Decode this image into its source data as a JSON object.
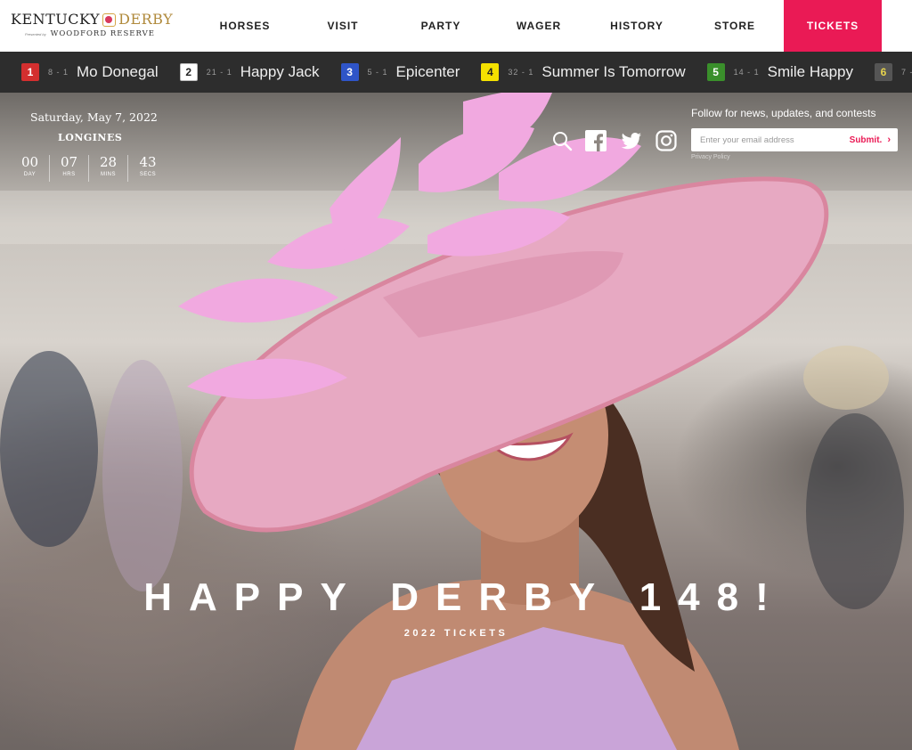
{
  "brand": {
    "name_part1": "KENTUCKY",
    "name_part2": "DERBY",
    "presented_by": "Presented by",
    "sponsor": "WOODFORD RESERVE"
  },
  "nav": {
    "items": [
      {
        "label": "HORSES"
      },
      {
        "label": "VISIT"
      },
      {
        "label": "PARTY"
      },
      {
        "label": "WAGER"
      },
      {
        "label": "HISTORY"
      },
      {
        "label": "STORE"
      }
    ],
    "tickets_label": "TICKETS",
    "accent_color": "#ea1a55"
  },
  "ticker": {
    "horses": [
      {
        "post": "1",
        "odds": "8 - 1",
        "name": "Mo Donegal",
        "color": "#d32f2f",
        "text_color": "#ffffff"
      },
      {
        "post": "2",
        "odds": "21 - 1",
        "name": "Happy Jack",
        "color": "#ffffff",
        "text_color": "#222222"
      },
      {
        "post": "3",
        "odds": "5 - 1",
        "name": "Epicenter",
        "color": "#2f55c8",
        "text_color": "#ffffff"
      },
      {
        "post": "4",
        "odds": "32 - 1",
        "name": "Summer Is Tomorrow",
        "color": "#f4e100",
        "text_color": "#222222"
      },
      {
        "post": "5",
        "odds": "14 - 1",
        "name": "Smile Happy",
        "color": "#3a8f2b",
        "text_color": "#ffffff"
      },
      {
        "post": "6",
        "odds": "7 - 1",
        "name": "",
        "color": "#555555",
        "text_color": "#e8d44d"
      }
    ]
  },
  "countdown": {
    "date": "Saturday, May 7, 2022",
    "sponsor": "LONGINES",
    "cells": [
      {
        "value": "00",
        "unit": "DAY"
      },
      {
        "value": "07",
        "unit": "HRS"
      },
      {
        "value": "28",
        "unit": "MINS"
      },
      {
        "value": "43",
        "unit": "SECS"
      }
    ]
  },
  "social": {
    "icons": [
      "search-icon",
      "facebook-icon",
      "twitter-icon",
      "instagram-icon"
    ]
  },
  "signup": {
    "prompt": "Follow for news, updates, and contests",
    "placeholder": "Enter your email address",
    "submit_label": "Submit.",
    "privacy_label": "Privacy Policy"
  },
  "hero": {
    "headline": "HAPPY DERBY 148!",
    "subline": "2022 TICKETS"
  }
}
